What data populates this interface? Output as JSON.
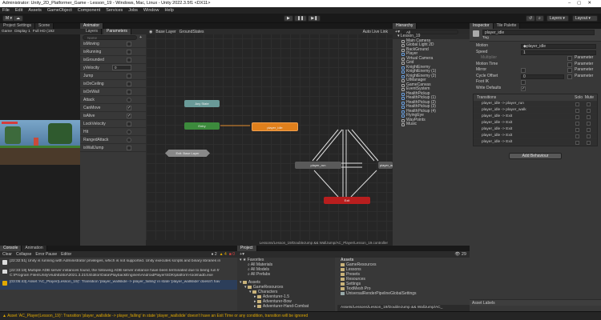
{
  "window": {
    "title": "Administrator: Unity_2D_Platformer_Game - Lesson_19 - Windows, Mac, Linux - Unity 2022.3.5f1 <DX11>"
  },
  "menu": [
    "File",
    "Edit",
    "Assets",
    "GameObject",
    "Component",
    "Services",
    "Jobs",
    "Window",
    "Help"
  ],
  "toolbar": {
    "account": "M",
    "layers": "Layers",
    "layout": "Layout"
  },
  "left_tabs": {
    "project_settings": "Project Settings",
    "scene": "Scene",
    "game": "Game",
    "display": "Display 1",
    "resolution": "Full HD (192"
  },
  "animator": {
    "tab": "Animator",
    "layers_tab": "Layers",
    "parameters_tab": "Parameters",
    "search_placeholder": "Name",
    "breadcrumb_base": "Base Layer",
    "breadcrumb_sub": "GroundStates",
    "auto_live": "Auto Live Link",
    "footer_path": "Lessons/Lesson_19/DoubleJump && WallJump/AC_Player/Lesson_19.controller",
    "parameters": [
      {
        "name": "isMoving",
        "type": "bool",
        "value": false
      },
      {
        "name": "isRunning",
        "type": "bool",
        "value": false
      },
      {
        "name": "isGrounded",
        "type": "bool",
        "value": false
      },
      {
        "name": "yVelocity",
        "type": "float",
        "value": "0"
      },
      {
        "name": "Jump",
        "type": "bool",
        "value": false
      },
      {
        "name": "isOnCeiling",
        "type": "bool",
        "value": false
      },
      {
        "name": "isOnWall",
        "type": "bool",
        "value": false
      },
      {
        "name": "Attack",
        "type": "trigger",
        "value": false
      },
      {
        "name": "CanMove",
        "type": "bool",
        "value": true
      },
      {
        "name": "isAlive",
        "type": "bool",
        "value": true
      },
      {
        "name": "LockVelocity",
        "type": "bool",
        "value": false
      },
      {
        "name": "Hit",
        "type": "trigger",
        "value": false
      },
      {
        "name": "RangedAttack",
        "type": "trigger",
        "value": false
      },
      {
        "name": "isWallJump",
        "type": "bool",
        "value": false
      }
    ],
    "nodes": {
      "any_state": "Any State",
      "entry": "Entry",
      "idle": "player_idle",
      "exit_base": "Exit: Base Layer",
      "run": "player_run",
      "walk": "player_walk",
      "exit": "Exit"
    }
  },
  "hierarchy": {
    "tab": "Hierarchy",
    "search_placeholder": "All",
    "root": "Lesson_19",
    "items": [
      "Main Camera",
      "Global Light 2D",
      "BackGround",
      "Player",
      "Virtual Camera",
      "Grid",
      "KnightEnemy",
      "KnightEnemy (1)",
      "KnightEnemy (2)",
      "UIManager",
      "GameCanvas",
      "EventSystem",
      "HealthPickup",
      "HealthPickup (1)",
      "HealthPickup (2)",
      "HealthPickup (3)",
      "HealthPickup (4)",
      "FlyingEye",
      "WayPoints",
      "Music"
    ]
  },
  "inspector": {
    "tab": "Inspector",
    "tab2": "Tile Palette",
    "state_name": "player_idle",
    "tag": "Tag",
    "fields": [
      {
        "label": "Motion",
        "value": "player_idle"
      },
      {
        "label": "Speed",
        "value": "1"
      },
      {
        "label": "Multiplier",
        "value": "",
        "param": "Parameter"
      },
      {
        "label": "Motion Time",
        "value": "",
        "param": "Parameter"
      },
      {
        "label": "Mirror",
        "value": "",
        "param": "Parameter"
      },
      {
        "label": "Cycle Offset",
        "value": "0",
        "param": "Parameter"
      },
      {
        "label": "Foot IK",
        "value": ""
      },
      {
        "label": "Write Defaults",
        "value": "✓"
      }
    ],
    "transitions_label": "Transitions",
    "solo": "Solo",
    "mute": "Mute",
    "transitions": [
      "player_idle -> player_run",
      "player_idle -> player_walk",
      "player_idle -> Exit",
      "player_idle -> Exit",
      "player_idle -> Exit",
      "player_idle -> Exit",
      "player_idle -> Exit"
    ],
    "add_behaviour": "Add Behaviour",
    "asset_labels": "Asset Labels"
  },
  "console": {
    "tab": "Console",
    "tab2": "Animation",
    "buttons": [
      "Clear",
      "Collapse",
      "Error Pause",
      "Editor"
    ],
    "count_info": "2",
    "count_warn": "4",
    "count_err": "0",
    "messages": [
      {
        "level": "info",
        "text": "[22:32:51] Unity is running with Administrator privileges, which is not supported. Unity executes scripts and binary libraries in"
      },
      {
        "level": "info",
        "text": "[22:33:18] Multiple ADB server instances found, the following ADB server instance have been terminated due to being run fr"
      },
      {
        "level": "info",
        "text": "C:\\Program Files\\Unity\\Hub\\Editor\\2021.3.21f1\\Editor\\Data\\PlaybackEngines\\AndroidPlayer\\SDK\\platform-tools\\adb.exe"
      },
      {
        "level": "warn",
        "text": "[03:05:43] Asset 'AC_Player(Lesson_19)': Transition 'player_wallslide -> player_falling' in state 'player_wallslide' doesn't hav"
      }
    ]
  },
  "project": {
    "tab": "Project",
    "favorites": "Favorites",
    "fav_items": [
      "All Materials",
      "All Models",
      "All Prefabs"
    ],
    "assets_root": "Assets",
    "tree": [
      "GameResources",
      "Characters",
      "Adventurer-1.5",
      "Adventurer-Bow",
      "Adventurer-Hand-Combat"
    ],
    "assets_header": "Assets",
    "assets_items": [
      "GameResources",
      "Lessons",
      "Presets",
      "Resources",
      "Settings",
      "TextMesh Pro",
      "UniversalRenderPipelineGlobalSettings"
    ],
    "footer_path": "Assets/Lessons/Lesson_19/DoubleJump && WallJump/AC_",
    "count": "29"
  },
  "status_bar": {
    "text": "Asset 'AC_Player(Lesson_19)': Transition 'player_wallslide -> player_falling' in state 'player_wallslide' doesn't have an Exit Time or any condition, transition will be ignored"
  }
}
